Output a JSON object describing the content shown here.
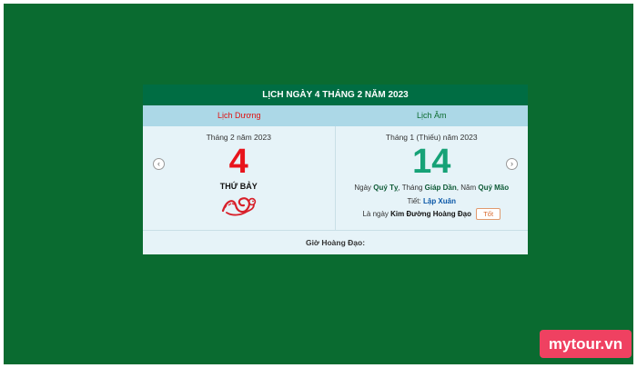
{
  "title": "LỊCH NGÀY 4 THÁNG 2 NĂM 2023",
  "headers": {
    "solar": "Lịch Dương",
    "lunar": "Lịch Âm"
  },
  "solar": {
    "month_year": "Tháng 2 năm 2023",
    "day": "4",
    "weekday": "THỨ BẢY"
  },
  "lunar": {
    "month_year": "Tháng 1 (Thiếu) năm 2023",
    "day": "14",
    "day_prefix": "Ngày",
    "day_name": "Quý Tỵ",
    "month_prefix": ", Tháng",
    "month_name": "Giáp Dần",
    "year_prefix": ", Năm",
    "year_name": "Quý Mão",
    "term_label": "Tiết:",
    "term_value": "Lập Xuân",
    "goodday_prefix": "Là ngày",
    "goodday_name": "Kim Đường Hoàng Đạo",
    "goodday_badge": "Tốt"
  },
  "footer": "Giờ Hoàng Đạo:",
  "nav": {
    "prev_icon": "chevron-left-icon",
    "next_icon": "chevron-right-icon"
  },
  "brand": "mytour.vn",
  "colors": {
    "background": "#0a6b30",
    "title_bar": "#006d43",
    "header_row": "#acd8e7",
    "solar_day": "#e8141c",
    "lunar_day": "#16a277",
    "brand": "#ef4161"
  }
}
